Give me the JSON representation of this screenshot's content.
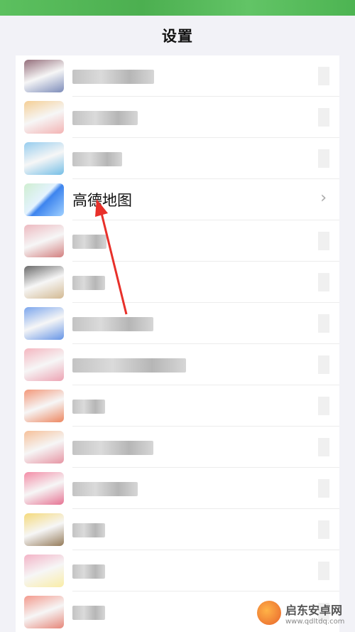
{
  "nav": {
    "title": "设置"
  },
  "highlighted_item": {
    "label": "高德地图",
    "chevron": "›"
  },
  "list_items": [
    {
      "icon_colors": [
        "#7a4a5a",
        "#5c6fa8"
      ],
      "text_width": 115
    },
    {
      "icon_colors": [
        "#f2c27a",
        "#f0a0a0"
      ],
      "text_width": 92
    },
    {
      "icon_colors": [
        "#7cc0ea",
        "#52aee0"
      ],
      "text_width": 70
    },
    {
      "highlight": true
    },
    {
      "icon_colors": [
        "#e8a8b0",
        "#c86060"
      ],
      "text_width": 48
    },
    {
      "icon_colors": [
        "#444444",
        "#c8a878"
      ],
      "text_width": 46
    },
    {
      "icon_colors": [
        "#5a8fe8",
        "#3f7ae0"
      ],
      "text_width": 114
    },
    {
      "icon_colors": [
        "#f2a4b0",
        "#e88ca0"
      ],
      "text_width": 160
    },
    {
      "icon_colors": [
        "#f07e58",
        "#e86838"
      ],
      "text_width": 46
    },
    {
      "icon_colors": [
        "#f4b080",
        "#e07a8c"
      ],
      "text_width": 114
    },
    {
      "icon_colors": [
        "#f07090",
        "#e05078"
      ],
      "text_width": 92
    },
    {
      "icon_colors": [
        "#f2d05a",
        "#7a5a30"
      ],
      "text_width": 46
    },
    {
      "icon_colors": [
        "#f0a0b8",
        "#f8e890"
      ],
      "text_width": 46
    },
    {
      "icon_colors": [
        "#f08070",
        "#e06858"
      ],
      "text_width": 46
    }
  ],
  "annotation": {
    "arrow_color": "#e8302a"
  },
  "watermark": {
    "name": "启东安卓网",
    "url": "www.qdltdq.com"
  }
}
